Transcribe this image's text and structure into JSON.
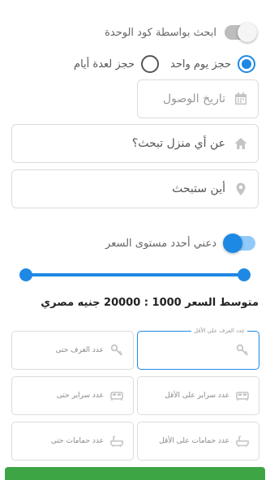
{
  "unit_code_toggle": {
    "label": "ابحث بواسطة كود الوحدة",
    "on": false
  },
  "booking_type": {
    "options": [
      {
        "label": "حجز يوم واحد",
        "checked": true
      },
      {
        "label": "حجز لعدة أيام",
        "checked": false
      }
    ]
  },
  "arrival_date": {
    "placeholder": "تاريخ الوصول",
    "icon": "calendar-icon"
  },
  "house_type": {
    "label": "عن أي منزل تبحث؟",
    "icon": "home-icon"
  },
  "location": {
    "label": "أين ستبحث",
    "icon": "map-pin-icon"
  },
  "price_toggle": {
    "label": "دعني أحدد مستوى السعر",
    "on": true
  },
  "price_slider": {
    "min": 1000,
    "max": 20000,
    "low": 1000,
    "high": 20000,
    "accent": "#1e88e5"
  },
  "average_price": {
    "text": "متوسط السعر 1000 : 20000 جنيه مصري"
  },
  "filters": {
    "rooms_from": {
      "placeholder": "عدد الغرف على الأقل",
      "float_label": "عدد الغرف على الأقل",
      "icon": "key-icon"
    },
    "rooms_to": {
      "placeholder": "عدد الغرف حتى",
      "icon": "key-icon"
    },
    "beds_from": {
      "placeholder": "عدد سراير على الأقل",
      "icon": "bed-icon"
    },
    "beds_to": {
      "placeholder": "عدد سراير حتى",
      "icon": "bed-icon"
    },
    "baths_from": {
      "placeholder": "عدد حمامات على الأقل",
      "icon": "bath-icon"
    },
    "baths_to": {
      "placeholder": "عدد حمامات حتى",
      "icon": "bath-icon"
    }
  },
  "search_button": {
    "color": "#3da544"
  }
}
